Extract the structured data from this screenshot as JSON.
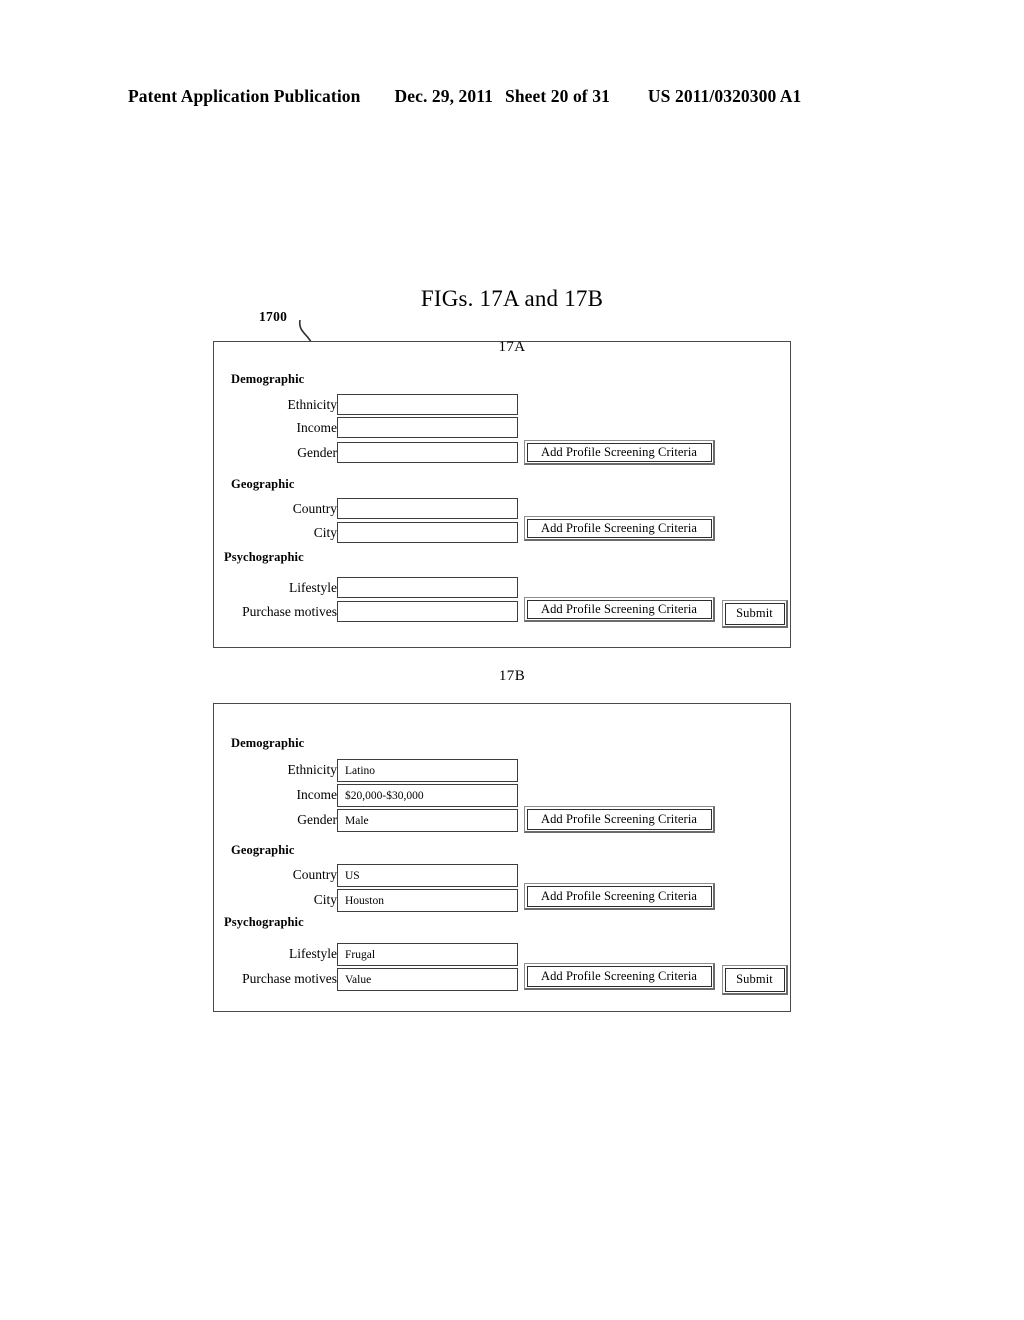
{
  "header": {
    "publication": "Patent Application Publication",
    "date": "Dec. 29, 2011",
    "sheet": "Sheet 20 of 31",
    "number": "US 2011/0320300 A1"
  },
  "figure": {
    "title": "FIGs. 17A and 17B",
    "reference_numeral": "1700",
    "panel_a_caption": "17A",
    "panel_b_caption": "17B"
  },
  "sections": {
    "demographic": "Demographic",
    "geographic": "Geographic",
    "psychographic": "Psychographic"
  },
  "labels": {
    "ethnicity": "Ethnicity",
    "income": "Income",
    "gender": "Gender",
    "country": "Country",
    "city": "City",
    "lifestyle": "Lifestyle",
    "purchase_motives": "Purchase motives"
  },
  "buttons": {
    "add_criteria": "Add Profile Screening Criteria",
    "submit": "Submit"
  },
  "panel_a": {
    "caption": "17A",
    "values": {
      "ethnicity": "",
      "income": "",
      "gender": "",
      "country": "",
      "city": "",
      "lifestyle": "",
      "purchase_motives": ""
    }
  },
  "panel_b": {
    "caption": "17B",
    "values": {
      "ethnicity": "Latino",
      "income": "$20,000-$30,000",
      "gender": "Male",
      "country": "US",
      "city": "Houston",
      "lifestyle": "Frugal",
      "purchase_motives": "Value"
    }
  },
  "colors": {
    "ink": "#000000",
    "panel_border": "#4a4a4a",
    "field_border": "#3d3d3d",
    "bevel_light": "#8e8e8e",
    "bevel_dark": "#6b6b6b",
    "page_background": "#ffffff"
  }
}
